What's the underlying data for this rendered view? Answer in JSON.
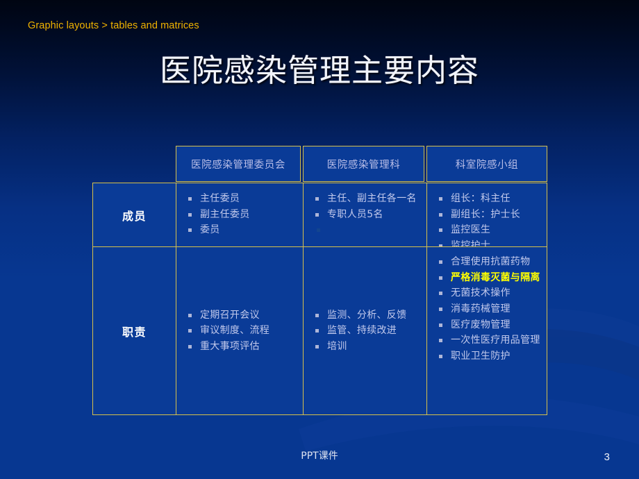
{
  "breadcrumb": "Graphic layouts > tables and matrices",
  "title": "医院感染管理主要内容",
  "colors": {
    "accent_border": "#d8c24a",
    "breadcrumb": "#f2b300",
    "cell_bg": "#0a3b97",
    "highlight": "#ffff00",
    "body_text": "#c2c9ec",
    "header_text": "#b9bee8"
  },
  "table": {
    "corner_label": "",
    "headers": [
      "医院感染管理委员会",
      "医院感染管理科",
      "科室院感小组"
    ],
    "rows": [
      {
        "label": "成员",
        "cells": [
          {
            "items": [
              {
                "text": "主任委员",
                "highlight": false
              },
              {
                "text": "副主任委员",
                "highlight": false
              },
              {
                "text": "委员",
                "highlight": false
              }
            ]
          },
          {
            "items": [
              {
                "text": "主任、副主任各一名",
                "highlight": false
              },
              {
                "text": "专职人员5名",
                "highlight": false
              },
              {
                "text": "",
                "highlight": false,
                "empty": true
              }
            ]
          },
          {
            "items": [
              {
                "text": "组长：科主任",
                "highlight": false
              },
              {
                "text": "副组长：护士长",
                "highlight": false
              },
              {
                "text": "监控医生",
                "highlight": false
              },
              {
                "text": "监控护士",
                "highlight": false
              }
            ]
          }
        ]
      },
      {
        "label": "职责",
        "cells": [
          {
            "items": [
              {
                "text": "定期召开会议",
                "highlight": false
              },
              {
                "text": "审议制度、流程",
                "highlight": false
              },
              {
                "text": "重大事项评估",
                "highlight": false
              }
            ]
          },
          {
            "items": [
              {
                "text": "监测、分析、反馈",
                "highlight": false
              },
              {
                "text": "监管、持续改进",
                "highlight": false
              },
              {
                "text": "培训",
                "highlight": false
              }
            ]
          },
          {
            "items": [
              {
                "text": "合理使用抗菌药物",
                "highlight": false
              },
              {
                "text": "严格消毒灭菌与隔离",
                "highlight": true
              },
              {
                "text": "无菌技术操作",
                "highlight": false
              },
              {
                "text": "消毒药械管理",
                "highlight": false
              },
              {
                "text": "医疗废物管理",
                "highlight": false
              },
              {
                "text": "一次性医疗用品管理",
                "highlight": false
              },
              {
                "text": "职业卫生防护",
                "highlight": false
              }
            ]
          }
        ]
      }
    ]
  },
  "footer": {
    "label": "PPT课件",
    "page_number": "3"
  }
}
